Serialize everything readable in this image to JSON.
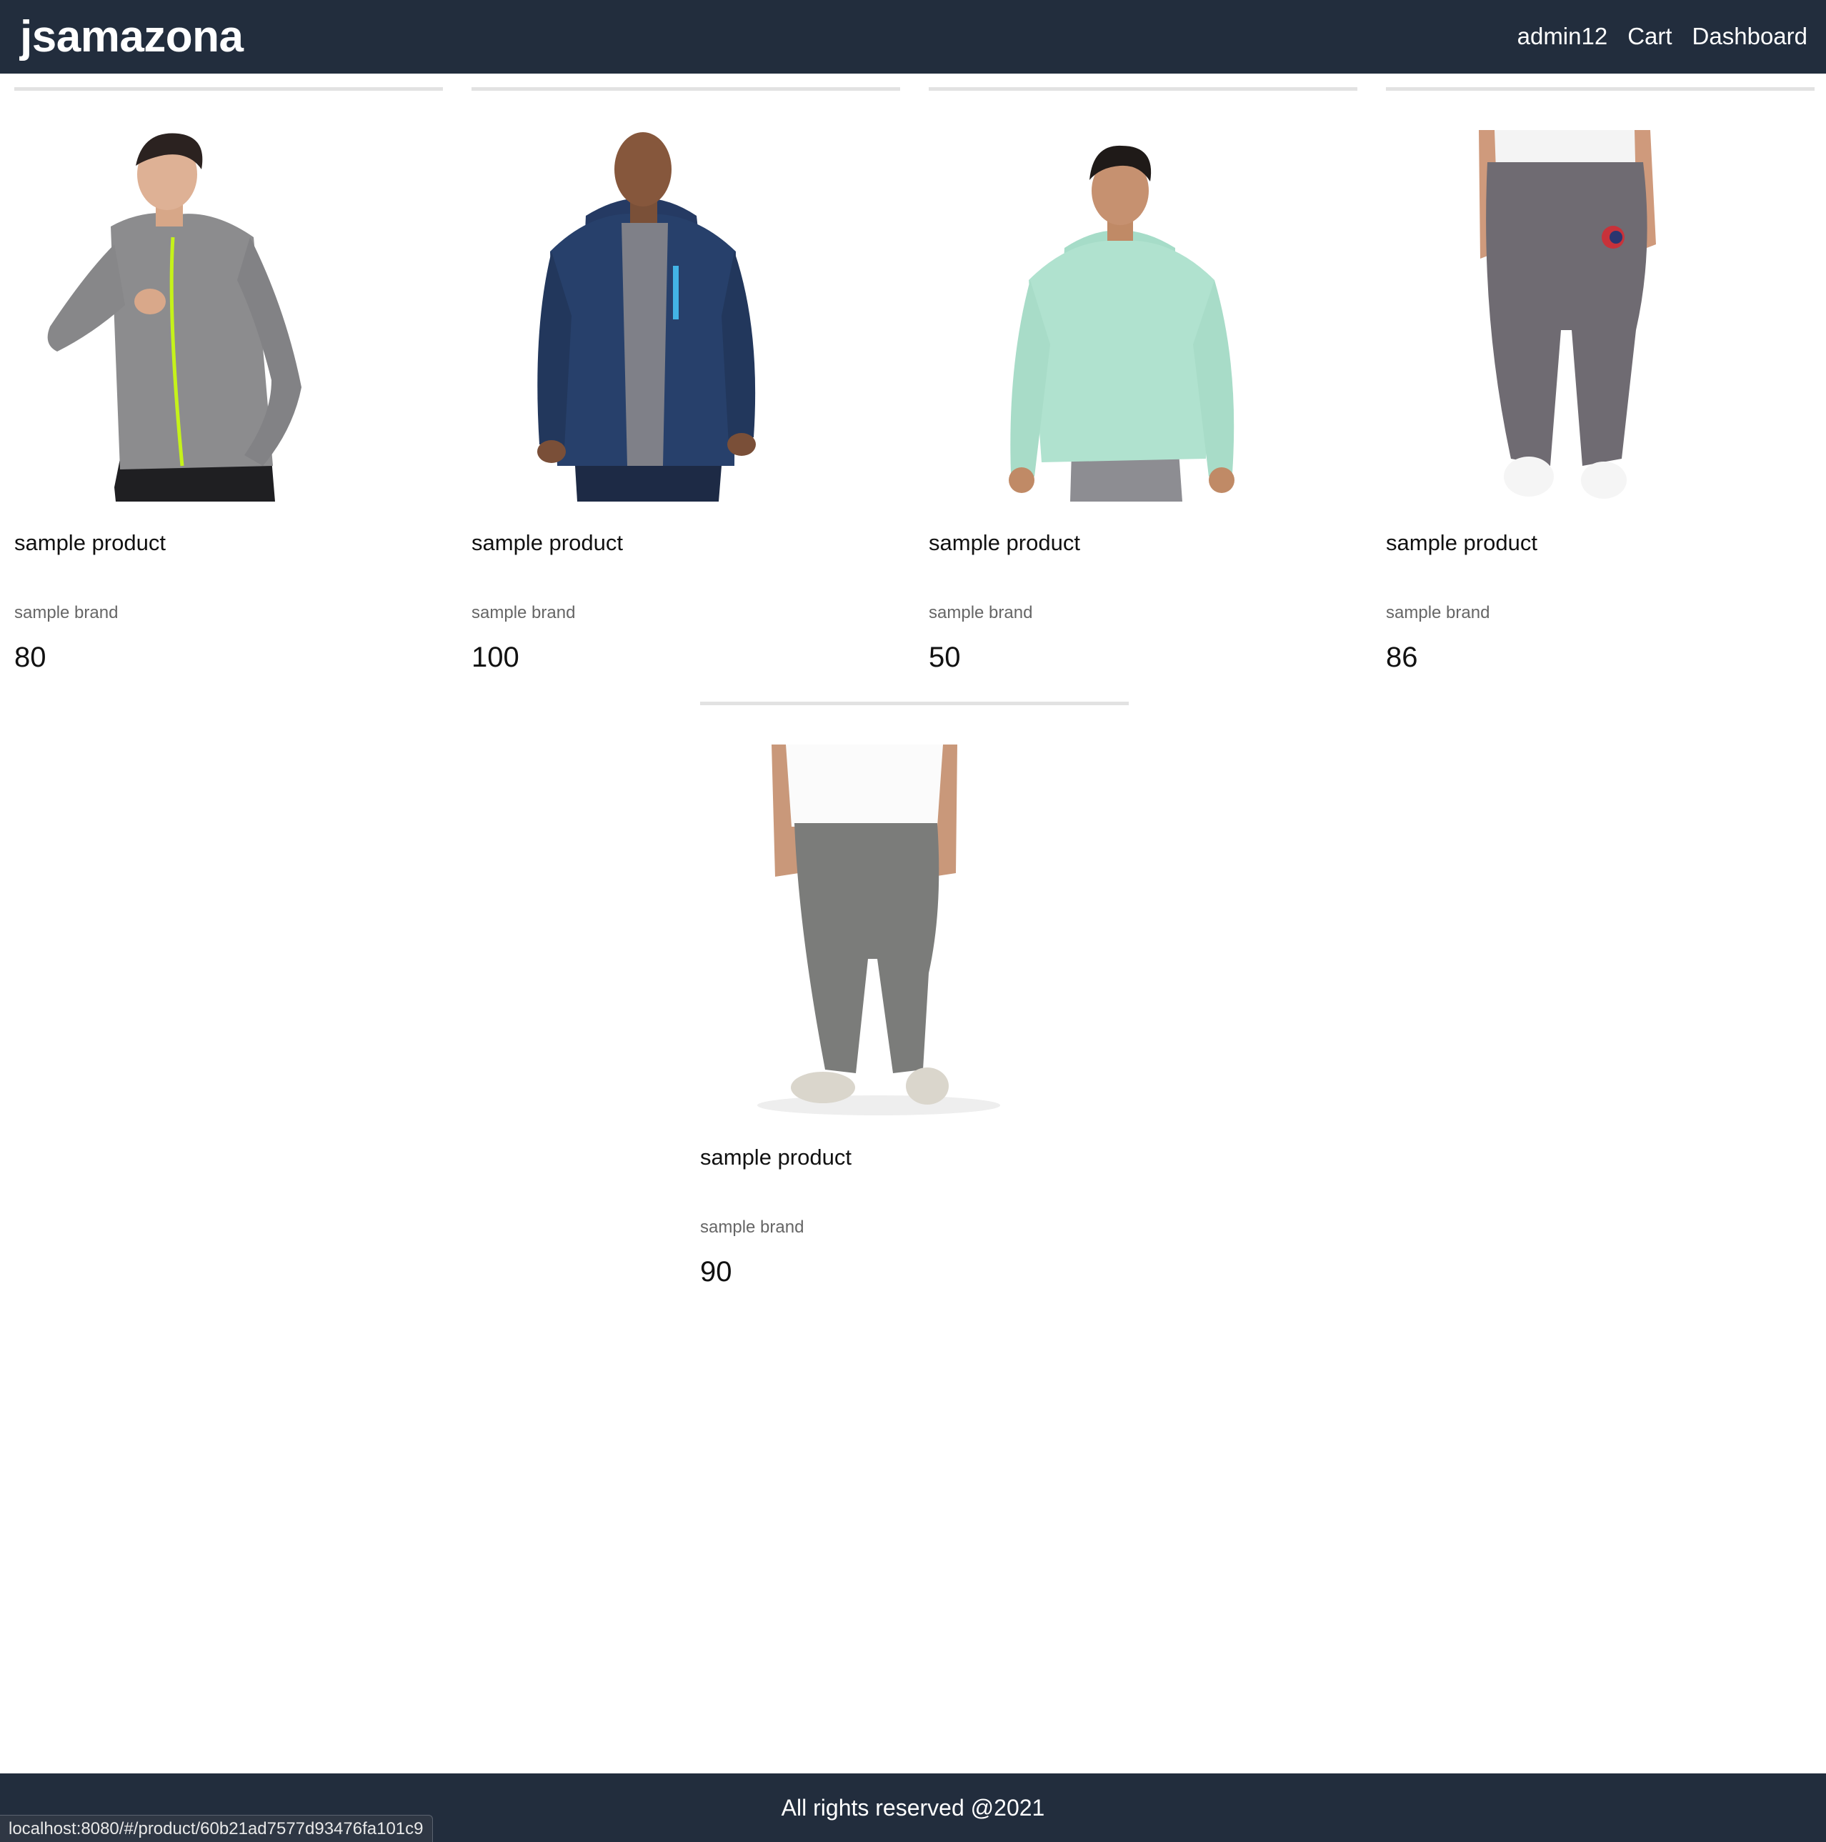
{
  "header": {
    "brand": "jsamazona",
    "nav": {
      "user": "admin12",
      "cart": "Cart",
      "dashboard": "Dashboard"
    }
  },
  "products": [
    {
      "name": "sample product",
      "brand": "sample brand",
      "price": "80",
      "image_icon": "gray-zip-jacket-photo"
    },
    {
      "name": "sample product",
      "brand": "sample brand",
      "price": "100",
      "image_icon": "navy-zip-hoodie-photo"
    },
    {
      "name": "sample product",
      "brand": "sample brand",
      "price": "50",
      "image_icon": "mint-hoodie-photo"
    },
    {
      "name": "sample product",
      "brand": "sample brand",
      "price": "86",
      "image_icon": "gray-joggers-photo"
    },
    {
      "name": "sample product",
      "brand": "sample brand",
      "price": "90",
      "image_icon": "gray-track-pants-photo"
    }
  ],
  "footer": {
    "copyright": "All rights reserved @2021"
  },
  "status_bar": {
    "url": "localhost:8080/#/product/60b21ad7577d93476fa101c9"
  },
  "colors": {
    "header_bg": "#222d3d",
    "card_divider": "#e2e2e2",
    "brand_text": "#666666"
  }
}
